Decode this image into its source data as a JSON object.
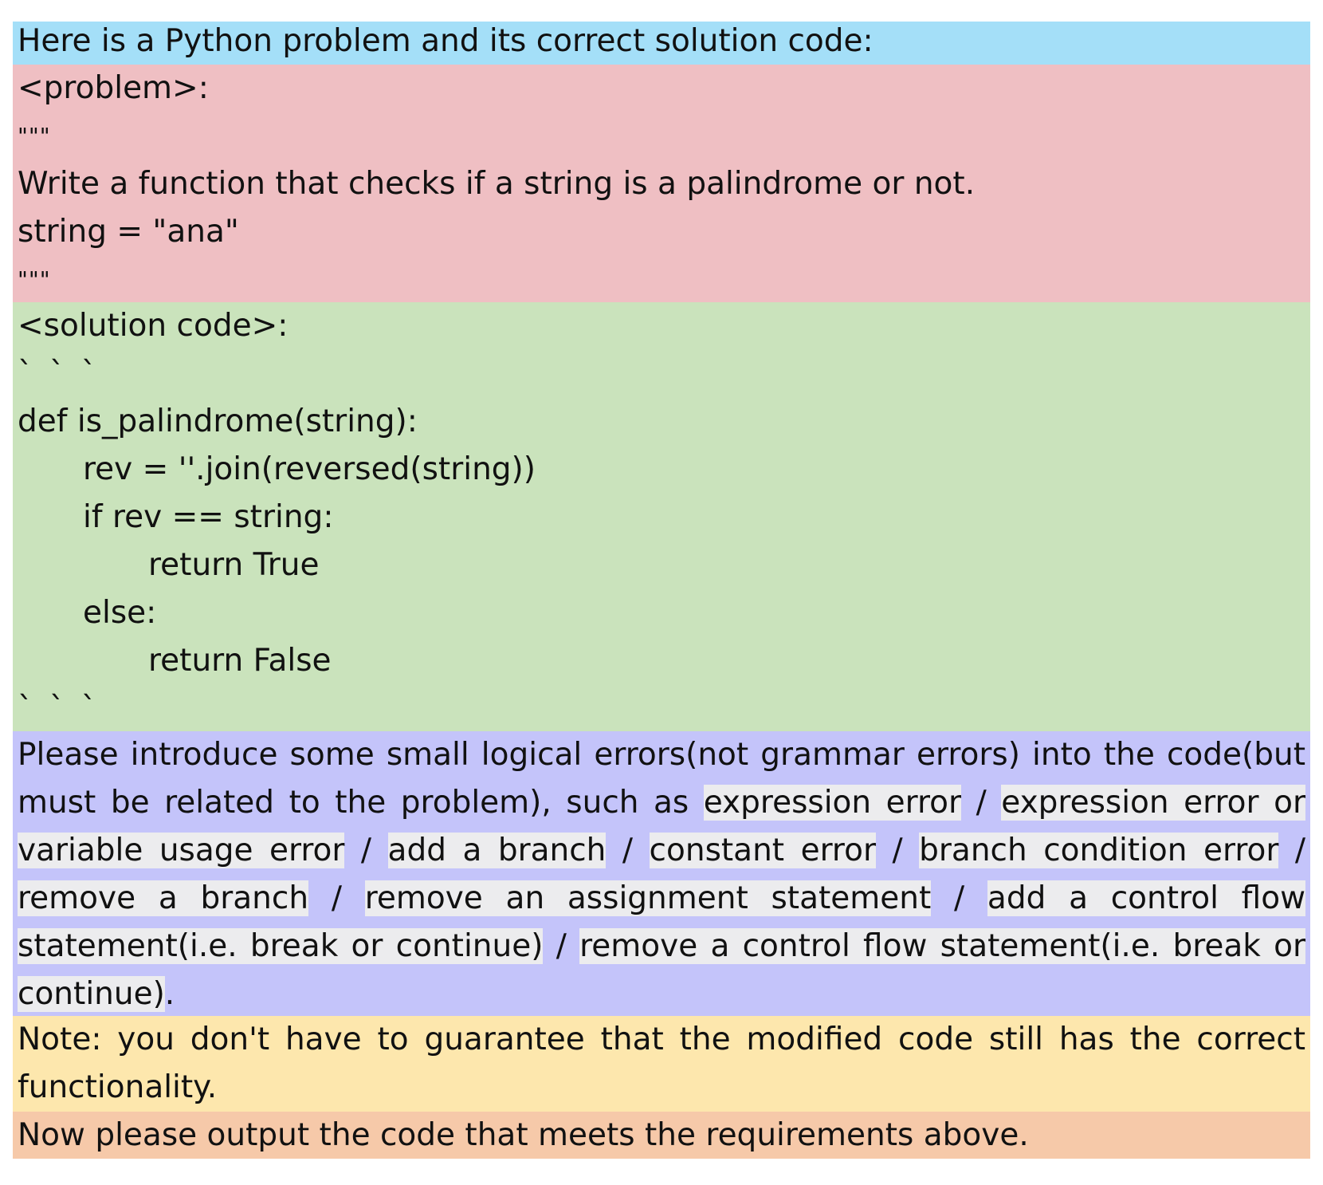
{
  "intro": "Here is a Python problem and its correct solution code:",
  "problem": {
    "tag": "<problem>:",
    "open_quotes": "\"\"\"",
    "text": "Write a function that checks if a string is a palindrome or not.",
    "example": "string = \"ana\"",
    "close_quotes": "\"\"\""
  },
  "solution": {
    "tag": "<solution code>:",
    "fence_open": "` ` `",
    "code": [
      "def is_palindrome(string):",
      "rev = ''.join(reversed(string))",
      "if rev == string:",
      "return True",
      "else:",
      "return False"
    ],
    "fence_close": "` ` `"
  },
  "instructions": {
    "lead": "Please introduce some small logical errors(not grammar errors) into the code(but must be related to the problem), such as",
    "error_types": [
      "expression error",
      "expression error or variable usage error",
      "add a branch",
      "constant error",
      "branch condition error",
      "remove a branch",
      "remove an assignment statement",
      "add a control flow statement(i.e. break or continue)",
      "remove a control flow statement(i.e. break or continue)"
    ],
    "separator": "/",
    "end": "."
  },
  "note": "Note: you don't have to guarantee that the modified code still has the correct functionality.",
  "final": "Now please output the code that meets the requirements above."
}
